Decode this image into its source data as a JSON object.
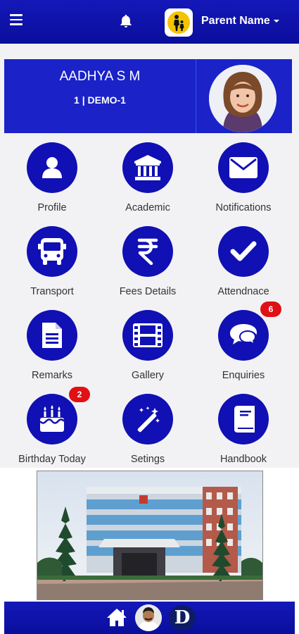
{
  "header": {
    "menu_icon": "menu-icon",
    "bell_icon": "bell-icon",
    "logo_icon": "parent-child-logo",
    "parent_name": "Parent Name"
  },
  "student": {
    "name": "AADHYA S M",
    "class": "1 | DEMO-1"
  },
  "tiles": [
    {
      "label": "Profile",
      "icon": "user-icon"
    },
    {
      "label": "Academic",
      "icon": "institution-icon"
    },
    {
      "label": "Notifications",
      "icon": "envelope-icon"
    },
    {
      "label": "Transport",
      "icon": "bus-icon"
    },
    {
      "label": "Fees Details",
      "icon": "rupee-icon"
    },
    {
      "label": "Attendnace",
      "icon": "checkmark-icon"
    },
    {
      "label": "Remarks",
      "icon": "document-icon"
    },
    {
      "label": "Gallery",
      "icon": "film-icon"
    },
    {
      "label": "Enquiries",
      "icon": "chat-bubbles-icon",
      "badge": "6"
    },
    {
      "label": "Birthday Today",
      "icon": "birthday-cake-icon",
      "badge": "2"
    },
    {
      "label": "Setings",
      "icon": "magic-wand-icon"
    },
    {
      "label": "Handbook",
      "icon": "book-icon"
    }
  ],
  "footer": {
    "home_icon": "home-icon",
    "logo_letter": "D"
  },
  "colors": {
    "primary": "#1010b4",
    "header": "#0a0e9c",
    "card": "#1a22c8",
    "badge": "#e01015"
  }
}
